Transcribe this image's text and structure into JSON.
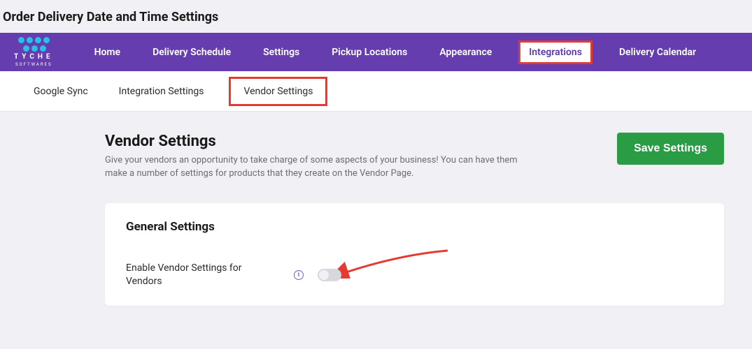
{
  "page": {
    "title": "Order Delivery Date and Time Settings"
  },
  "brand": {
    "name": "TYCHE",
    "sub": "SOFTWARES"
  },
  "nav": {
    "items": [
      {
        "label": "Home"
      },
      {
        "label": "Delivery Schedule"
      },
      {
        "label": "Settings"
      },
      {
        "label": "Pickup Locations"
      },
      {
        "label": "Appearance"
      },
      {
        "label": "Integrations",
        "active": true
      },
      {
        "label": "Delivery Calendar"
      }
    ]
  },
  "subtabs": {
    "items": [
      {
        "label": "Google Sync"
      },
      {
        "label": "Integration Settings"
      },
      {
        "label": "Vendor Settings",
        "active": true
      }
    ]
  },
  "section": {
    "title": "Vendor Settings",
    "desc": "Give your vendors an opportunity to take charge of some aspects of your business! You can have them make a number of settings for products that they create on the Vendor Page.",
    "save_label": "Save Settings"
  },
  "panel": {
    "title": "General Settings",
    "setting_label": "Enable Vendor Settings for Vendors",
    "toggle_on": false
  }
}
